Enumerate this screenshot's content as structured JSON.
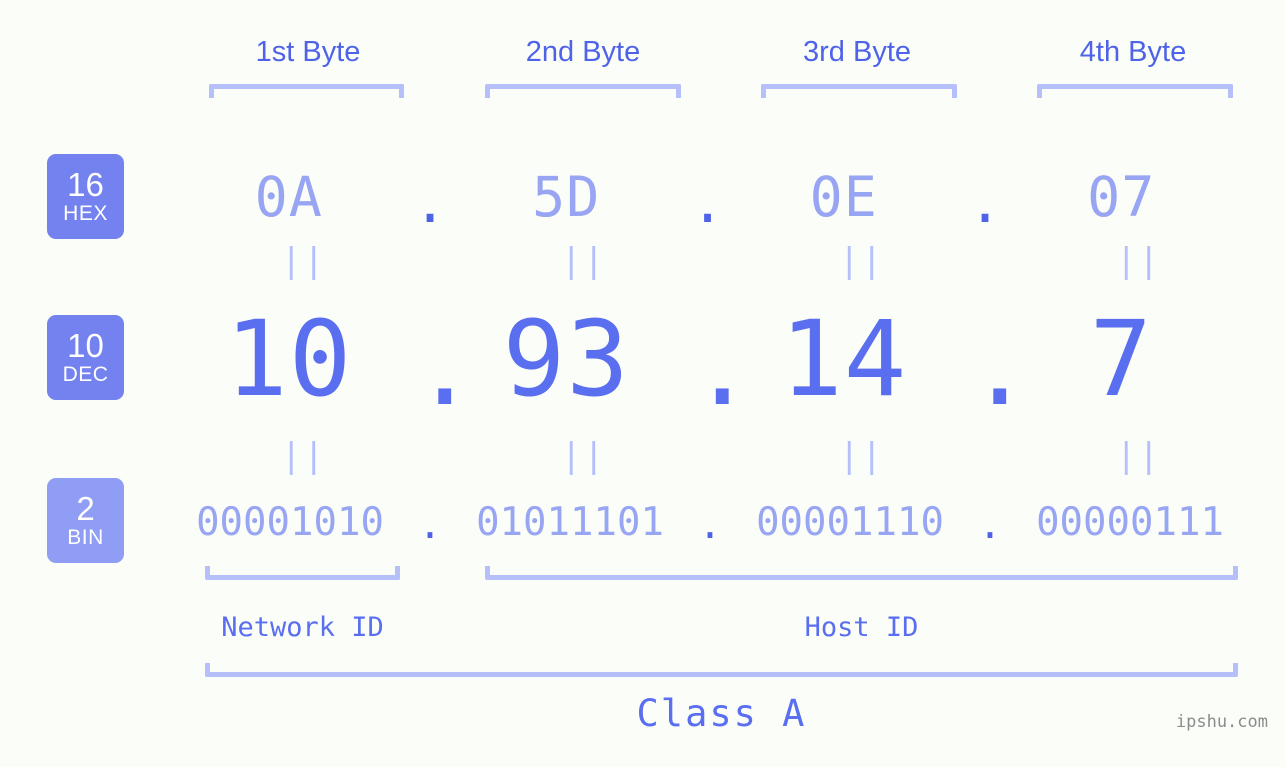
{
  "page": {
    "background_color": "#fbfdf8",
    "accent_color": "#5a6ef0",
    "light_accent_color": "#98a5f3",
    "bracket_color": "#b5c0fb",
    "badge_color": "#7382ef",
    "watermark": "ipshu.com"
  },
  "byte_headers": [
    {
      "label": "1st Byte"
    },
    {
      "label": "2nd Byte"
    },
    {
      "label": "3rd Byte"
    },
    {
      "label": "4th Byte"
    }
  ],
  "rows": [
    {
      "id": "hex",
      "badge_base": "16",
      "badge_name": "HEX",
      "values": [
        "0A",
        "5D",
        "0E",
        "07"
      ],
      "separator": "."
    },
    {
      "id": "dec",
      "badge_base": "10",
      "badge_name": "DEC",
      "values": [
        "10",
        "93",
        "14",
        "7"
      ],
      "separator": "."
    },
    {
      "id": "bin",
      "badge_base": "2",
      "badge_name": "BIN",
      "values": [
        "00001010",
        "01011101",
        "00001110",
        "00000111"
      ],
      "separator": "."
    }
  ],
  "equals_marks": {
    "glyph": "||",
    "count_per_row": 4
  },
  "footer": {
    "network_id_label": "Network ID",
    "host_id_label": "Host ID",
    "class_label": "Class A"
  }
}
